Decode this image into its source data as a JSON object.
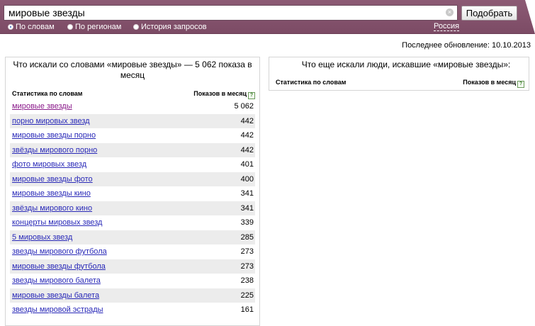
{
  "search": {
    "query": "мировые звезды",
    "button_label": "Подобрать",
    "clear_glyph": "×"
  },
  "modes": [
    {
      "label": "По словам",
      "selected": true
    },
    {
      "label": "По регионам",
      "selected": false
    },
    {
      "label": "История запросов",
      "selected": false
    }
  ],
  "region_label": "Россия",
  "last_update": "Последнее обновление: 10.10.2013",
  "left_panel": {
    "title": "Что искали со словами «мировые звезды» — 5 062 показа в месяц",
    "col_keyword": "Статистика по словам",
    "col_shows": "Показов в месяц",
    "help_glyph": "?",
    "rows": [
      {
        "keyword": "мировые звезды",
        "shows": "5 062"
      },
      {
        "keyword": "порно мировых звезд",
        "shows": "442"
      },
      {
        "keyword": "мировые звезды порно",
        "shows": "442"
      },
      {
        "keyword": "звёзды мирового порно",
        "shows": "442"
      },
      {
        "keyword": "фото мировых звезд",
        "shows": "401"
      },
      {
        "keyword": "мировые звезды фото",
        "shows": "400"
      },
      {
        "keyword": "мировые звезды кино",
        "shows": "341"
      },
      {
        "keyword": "звёзды мирового кино",
        "shows": "341"
      },
      {
        "keyword": "концерты мировых звезд",
        "shows": "339"
      },
      {
        "keyword": "5 мировых звезд",
        "shows": "285"
      },
      {
        "keyword": "звезды мирового футбола",
        "shows": "273"
      },
      {
        "keyword": "мировые звезды футбола",
        "shows": "273"
      },
      {
        "keyword": "звезды мирового балета",
        "shows": "238"
      },
      {
        "keyword": "мировые звезды балета",
        "shows": "225"
      },
      {
        "keyword": "звезды мировой эстрады",
        "shows": "161"
      }
    ]
  },
  "right_panel": {
    "title": "Что еще искали люди, искавшие «мировые звезды»:",
    "col_keyword": "Статистика по словам",
    "col_shows": "Показов в месяц",
    "help_glyph": "?"
  }
}
